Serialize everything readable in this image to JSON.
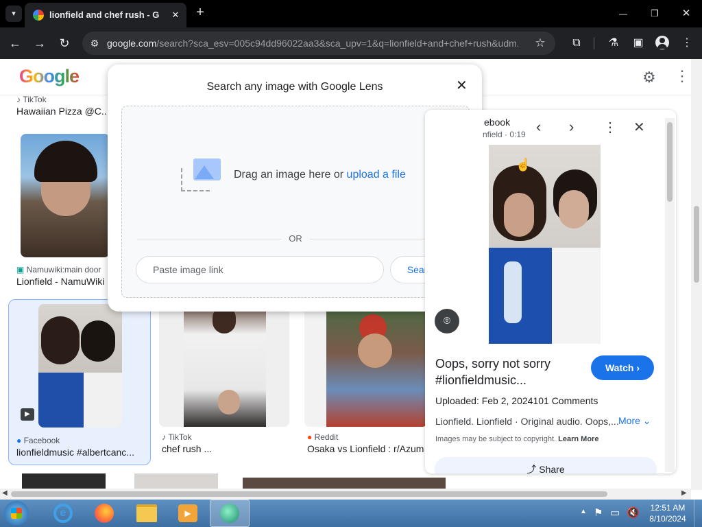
{
  "browser": {
    "tab_title": "lionfield and chef rush - Googl",
    "new_tab": "+",
    "url_host": "google.com",
    "url_path": "/search?sca_esv=005c94dd96022aa3&sca_upv=1&q=lionfield+and+chef+rush&udm...",
    "window_controls": {
      "minimize": "—",
      "restore": "❐",
      "close": "✕"
    }
  },
  "google": {
    "logo_text": "Google"
  },
  "results": {
    "top": {
      "source": "TikTok",
      "title": "Hawaiian Pizza @C..."
    },
    "row1": [
      {
        "source": "Namuwiki:main door",
        "title": "Lionfield - NamuWiki"
      }
    ],
    "row2": [
      {
        "source": "Facebook",
        "title": "lionfieldmusic #albertcanc..."
      },
      {
        "source": "TikTok",
        "title": "chef rush ..."
      },
      {
        "source": "Reddit",
        "title": "Osaka vs Lionfield : r/Azum"
      }
    ]
  },
  "lens": {
    "title": "Search any image with Google Lens",
    "drag_text": "Drag an image here or",
    "upload_link": "upload a file",
    "or_label": "OR",
    "paste_placeholder": "Paste image link",
    "search_button": "Search"
  },
  "panel": {
    "source": "ebook",
    "sub": "nfield · 0:19",
    "title_line1": "Oops, sorry not sorry",
    "title_line2": "#lionfieldmusic...",
    "watch": "Watch",
    "uploaded": "Uploaded: Feb 2, 2024",
    "comments": "101 Comments",
    "description": "Lionfield. Lionfield · Original audio. Oops,...",
    "more": "More",
    "copyright": "Images may be subject to copyright.",
    "learn_more": "Learn More",
    "share": "Share"
  },
  "taskbar": {
    "time": "12:51 AM",
    "date": "8/10/2024"
  }
}
